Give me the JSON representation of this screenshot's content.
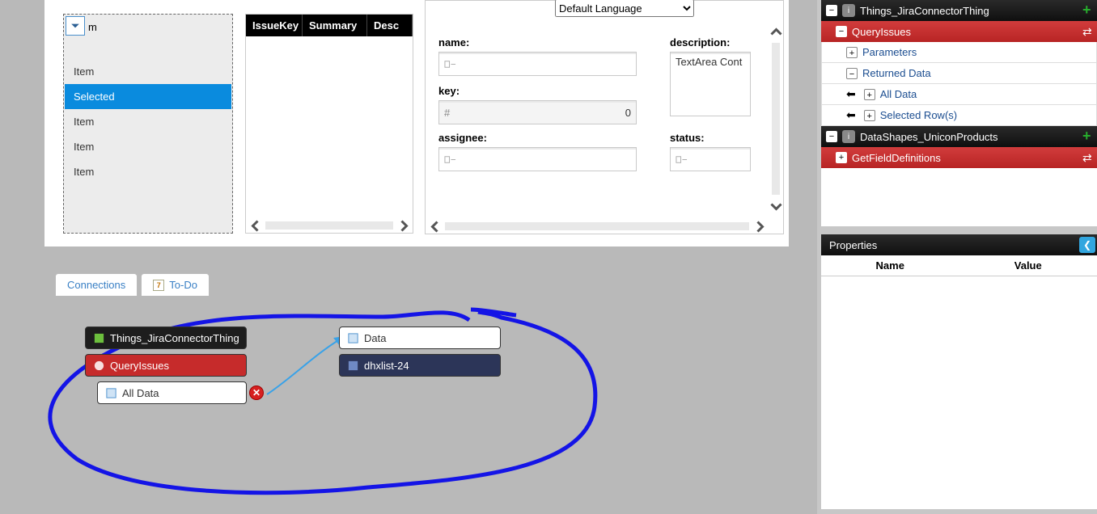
{
  "form_area": {
    "list": {
      "fragment": "m",
      "items": [
        "Item",
        "Selected",
        "Item",
        "Item",
        "Item"
      ],
      "selected_index": 1
    },
    "grid": {
      "columns": [
        "IssueKey",
        "Summary",
        "Desc"
      ]
    },
    "form": {
      "language_selector": "Default Language",
      "fields": {
        "name": {
          "label": "name:",
          "value": ""
        },
        "description": {
          "label": "description:",
          "value": "TextArea Cont"
        },
        "key": {
          "label": "key:",
          "placeholder": "#",
          "value": "0"
        },
        "assignee": {
          "label": "assignee:",
          "value": ""
        },
        "status": {
          "label": "status:",
          "value": ""
        }
      }
    }
  },
  "bottom_tabs": {
    "connections": "Connections",
    "todo": "To-Do",
    "todo_badge": "7"
  },
  "diagram": {
    "thing_node": "Things_JiraConnectorThing",
    "service_node": "QueryIssues",
    "alldata_node": "All Data",
    "data_node": "Data",
    "widget_node": "dhxlist-24"
  },
  "sidebar_tree": {
    "thing": "Things_JiraConnectorThing",
    "service": "QueryIssues",
    "params": "Parameters",
    "returned": "Returned Data",
    "alldata": "All Data",
    "selrows": "Selected Row(s)",
    "datashape": "DataShapes_UniconProducts",
    "getfield": "GetFieldDefinitions"
  },
  "properties": {
    "title": "Properties",
    "col_name": "Name",
    "col_value": "Value"
  }
}
